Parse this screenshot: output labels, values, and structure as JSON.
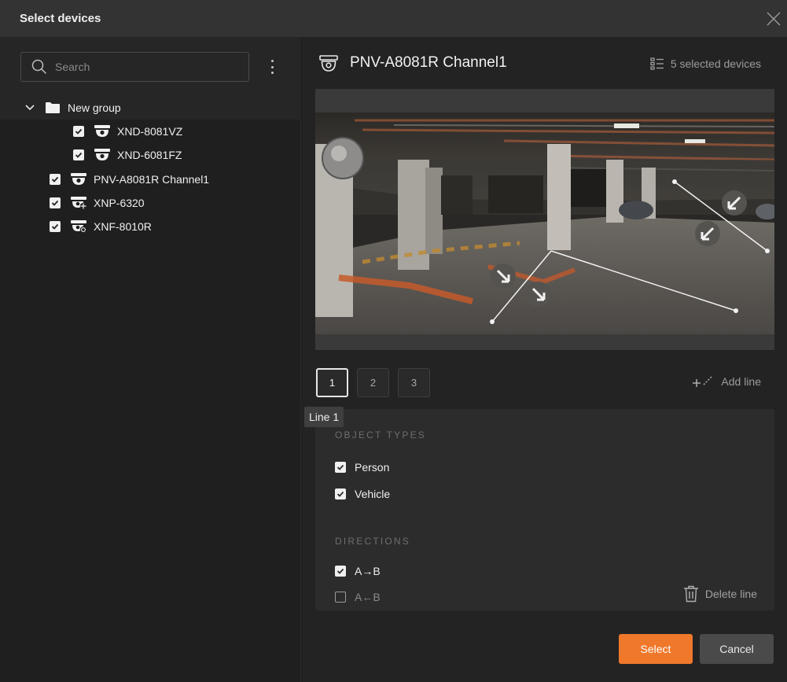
{
  "dialog": {
    "title": "Select devices"
  },
  "search": {
    "placeholder": "Search"
  },
  "tree": {
    "group_label": "New group",
    "devices": [
      {
        "name": "XND-8081VZ",
        "checked": true,
        "icon": "dome-camera-icon"
      },
      {
        "name": "XND-6081FZ",
        "checked": true,
        "icon": "dome-camera-icon"
      },
      {
        "name": "PNV-A8081R Channel1",
        "checked": true,
        "icon": "dome-camera-icon"
      },
      {
        "name": "XNP-6320",
        "checked": true,
        "icon": "ptz-camera-icon"
      },
      {
        "name": "XNF-8010R",
        "checked": true,
        "icon": "fisheye-camera-icon"
      }
    ]
  },
  "header": {
    "camera_title": "PNV-A8081R Channel1",
    "selected_devices": "5 selected devices"
  },
  "lines": {
    "tabs": [
      "1",
      "2",
      "3"
    ],
    "active_tab": "1",
    "add_line": "Add line",
    "tooltip": "Line 1"
  },
  "object_types": {
    "label": "OBJECT TYPES",
    "items": [
      {
        "label": "Person",
        "checked": true
      },
      {
        "label": "Vehicle",
        "checked": true
      }
    ]
  },
  "directions": {
    "label": "DIRECTIONS",
    "items": [
      {
        "label": "A→B",
        "checked": true
      },
      {
        "label": "A←B",
        "checked": false
      }
    ]
  },
  "delete_line": "Delete line",
  "buttons": {
    "select": "Select",
    "cancel": "Cancel"
  },
  "colors": {
    "accent": "#f0782a",
    "background": "#1e1e1e",
    "panel": "#2c2c2c"
  }
}
